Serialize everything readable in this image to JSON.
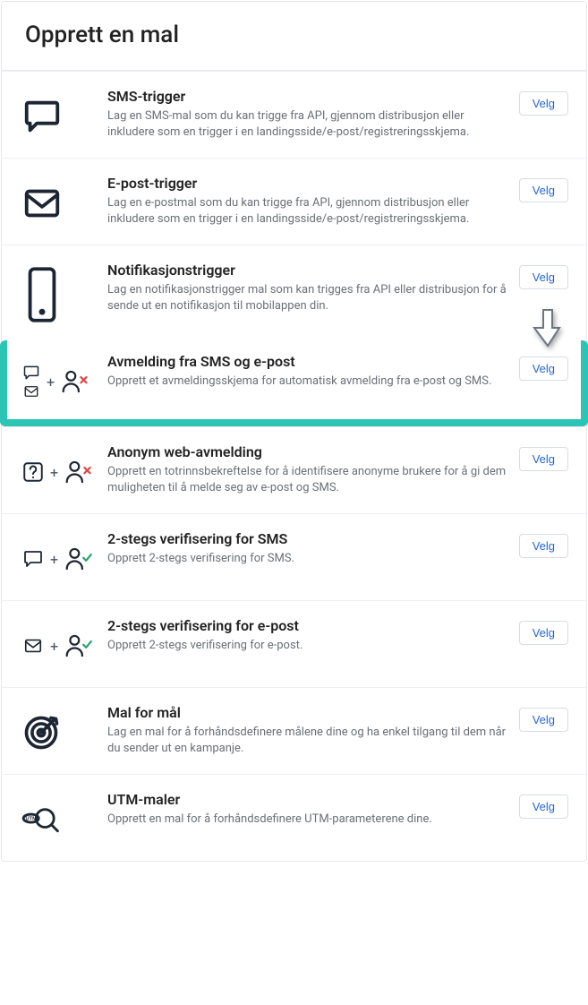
{
  "header": {
    "title": "Opprett en mal"
  },
  "button_label": "Velg",
  "rows": [
    {
      "id": "sms-trigger",
      "title": "SMS-trigger",
      "desc": "Lag en SMS-mal som du kan trigge fra API, gjennom distribusjon eller inkludere som en trigger i en landingsside/e-post/registreringsskjema."
    },
    {
      "id": "epost-trigger",
      "title": "E-post-trigger",
      "desc": "Lag en e-postmal som du kan trigge fra API, gjennom distribusjon eller inkludere som en trigger i en landingsside/e-post/registreringsskjema."
    },
    {
      "id": "notifikasjon-trigger",
      "title": "Notifikasjonstrigger",
      "desc": "Lag en notifikasjonstrigger mal som kan trigges fra API eller distribusjon for å sende ut en notifikasjon til mobilappen din."
    },
    {
      "id": "avmelding",
      "title": "Avmelding fra SMS og e-post",
      "desc": "Opprett et avmeldingsskjema for automatisk avmelding fra e-post og SMS."
    },
    {
      "id": "anonym-avmelding",
      "title": "Anonym web-avmelding",
      "desc": "Opprett en totrinnsbekreftelse for å identifisere anonyme brukere for å gi dem muligheten til å melde seg av e-post og SMS."
    },
    {
      "id": "2step-sms",
      "title": "2-stegs verifisering for SMS",
      "desc": "Opprett 2-stegs verifisering for SMS."
    },
    {
      "id": "2step-epost",
      "title": "2-stegs verifisering for e-post",
      "desc": "Opprett 2-stegs verifisering for e-post."
    },
    {
      "id": "mal-for-mal",
      "title": "Mal for mål",
      "desc": "Lag en mal for å forhåndsdefinere målene dine og ha enkel tilgang til dem når du sender ut en kampanje."
    },
    {
      "id": "utm-maler",
      "title": "UTM-maler",
      "desc": "Opprett en mal for å forhåndsdefinere UTM-parameterene dine."
    }
  ]
}
